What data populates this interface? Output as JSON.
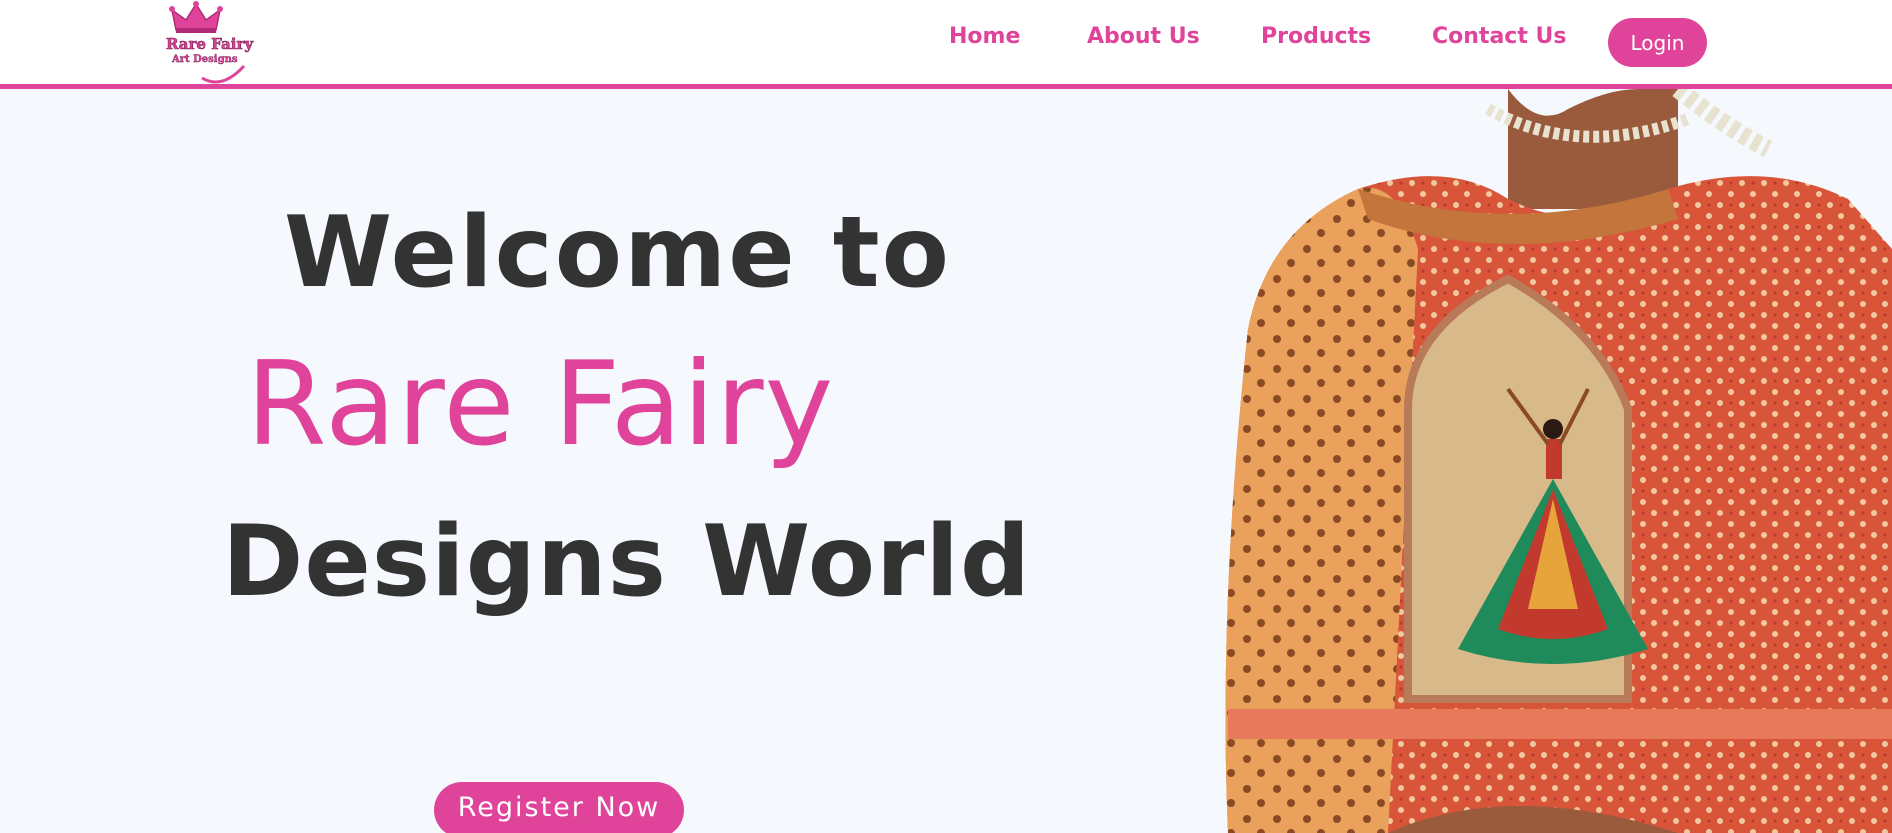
{
  "brand": {
    "logo_text_top": "Rare Fairy",
    "logo_text_bottom": "Art Designs"
  },
  "nav": {
    "items": [
      {
        "label": "Home"
      },
      {
        "label": "About Us"
      },
      {
        "label": "Products"
      },
      {
        "label": "Contact Us"
      }
    ],
    "login_label": "Login"
  },
  "hero": {
    "line1": "Welcome to",
    "line2": "Rare Fairy",
    "line3": "Designs World",
    "register_label": "Register Now",
    "image_subject": "embroidered-blouse-back"
  },
  "colors": {
    "accent": "#e0449a",
    "text_dark": "#333333",
    "background": "#f5f8fd"
  }
}
